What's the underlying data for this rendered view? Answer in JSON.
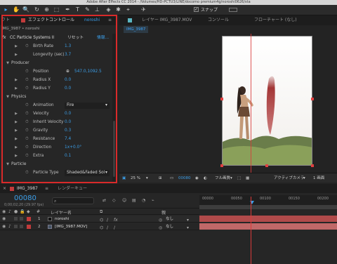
{
  "window": {
    "title": "Adobe After Effects CC 2014 - /Volumes/HD-PCTU3/LINE/docomo premium4g/noroshi0626/sta"
  },
  "toolbar": {
    "tools": [
      "▸",
      "✋",
      "🔍",
      "↻",
      "⊕",
      "⬚",
      "✒",
      "T",
      "✎",
      "⊥",
      "◈",
      "✱",
      "⌖",
      "✈"
    ],
    "snap_label": "スナップ",
    "snap_check": "✓"
  },
  "effect_panel": {
    "tab_left": "クト",
    "tab_main": "エフェクトコントロール",
    "tab_target": "noroshi",
    "menu_icon": "≡",
    "breadcrumb": "IMG_3987 • noroshi",
    "effect_name": "CC Particle Systems II",
    "reset_label": "リセット",
    "info_label": "情報...",
    "fx_label": "fx",
    "rows": [
      {
        "kind": "prop",
        "twirl": "▶",
        "stopwatch": "⏱",
        "label": "Birth Rate",
        "value": "1.3"
      },
      {
        "kind": "prop",
        "twirl": "▶",
        "stopwatch": "",
        "label": "Longevity (sec)",
        "value": "3.7"
      },
      {
        "kind": "group",
        "twirl": "▼",
        "label": "Producer"
      },
      {
        "kind": "prop",
        "twirl": "",
        "stopwatch": "⏱",
        "label": "Position",
        "value": "547.0,1092.5",
        "crosshair": "⊕"
      },
      {
        "kind": "prop",
        "twirl": "▶",
        "stopwatch": "⏱",
        "label": "Radius X",
        "value": "0.0"
      },
      {
        "kind": "prop",
        "twirl": "▶",
        "stopwatch": "⏱",
        "label": "Radius Y",
        "value": "0.0"
      },
      {
        "kind": "group",
        "twirl": "▼",
        "label": "Physics"
      },
      {
        "kind": "prop",
        "twirl": "",
        "stopwatch": "⏱",
        "label": "Animation",
        "value": "Fire",
        "dropdown": true
      },
      {
        "kind": "prop",
        "twirl": "▶",
        "stopwatch": "⏱",
        "label": "Velocity",
        "value": "0.0"
      },
      {
        "kind": "prop",
        "twirl": "▶",
        "stopwatch": "⏱",
        "label": "Inherit Velocity",
        "value": "0.0"
      },
      {
        "kind": "prop",
        "twirl": "▶",
        "stopwatch": "⏱",
        "label": "Gravity",
        "value": "0.3"
      },
      {
        "kind": "prop",
        "twirl": "▶",
        "stopwatch": "⏱",
        "label": "Resistance",
        "value": "7.4"
      },
      {
        "kind": "prop",
        "twirl": "▶",
        "stopwatch": "⏱",
        "label": "Direction",
        "value": "1x+0.0°"
      },
      {
        "kind": "prop",
        "twirl": "▶",
        "stopwatch": "⏱",
        "label": "Extra",
        "value": "0.1"
      },
      {
        "kind": "group",
        "twirl": "▼",
        "label": "Particle"
      },
      {
        "kind": "prop",
        "twirl": "",
        "stopwatch": "⏱",
        "label": "Particle Type",
        "value": "Shaded&Faded Sol",
        "dropdown": true
      }
    ]
  },
  "viewer": {
    "tabs": [
      "レイヤー IMG_3987.MOV",
      "コンソール",
      "フローチャート (なし)"
    ],
    "comp_tab": "IMG_3987",
    "zoom": "25 %",
    "frame": "00080",
    "resolution": "フル画質",
    "camera": "アクティブカメラ",
    "views": "1 画面"
  },
  "timeline": {
    "comp_tab": "IMG_3987",
    "render_queue_tab": "レンダーキュー",
    "timecode": "00080",
    "timecode_sub": "0;00;02;20 (29.97 fps)",
    "search_icon": "search-icon",
    "col_num": "#",
    "col_layer_name": "レイヤー名",
    "col_parent": "親",
    "ruler_ticks": [
      "00000",
      "00050",
      "00100",
      "00150",
      "00200"
    ],
    "layers": [
      {
        "num": "1",
        "name": "noroshi",
        "label_color": "#c23b3b",
        "parent": "なし",
        "bar_color": "#b04a4a"
      },
      {
        "num": "2",
        "name": "[IMG_3987.MOV]",
        "label_color": "#c23b3b",
        "parent": "なし",
        "bar_color": "#c06868"
      }
    ]
  },
  "colors": {
    "accent": "#3b9ee8",
    "highlight_box": "#d92a2a",
    "playhead": "#d93a3a"
  }
}
